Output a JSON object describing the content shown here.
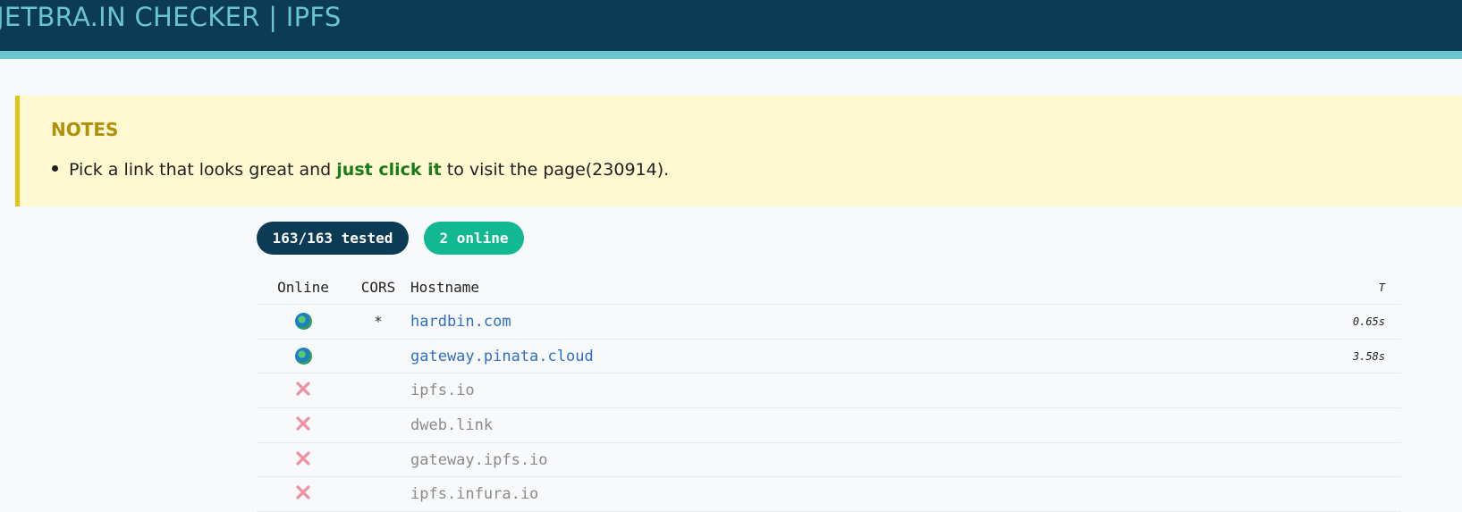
{
  "header": {
    "title": "JETBRA.IN CHECKER | IPFS"
  },
  "notes": {
    "title": "NOTES",
    "item_before": "Pick a link that looks great and ",
    "item_emphasis": "just click it",
    "item_after": " to visit the page(230914)."
  },
  "badges": {
    "tested": "163/163 tested",
    "online": "2 online"
  },
  "table": {
    "columns": {
      "online": "Online",
      "cors": "CORS",
      "hostname": "Hostname",
      "time": "T"
    },
    "rows": [
      {
        "online": "globe-icon",
        "cors": "*",
        "hostname": "hardbin.com",
        "time": "0.65s",
        "status": "online"
      },
      {
        "online": "globe-icon",
        "cors": "",
        "hostname": "gateway.pinata.cloud",
        "time": "3.58s",
        "status": "online"
      },
      {
        "online": "cross-icon",
        "cors": "",
        "hostname": "ipfs.io",
        "time": "",
        "status": "offline"
      },
      {
        "online": "cross-icon",
        "cors": "",
        "hostname": "dweb.link",
        "time": "",
        "status": "offline"
      },
      {
        "online": "cross-icon",
        "cors": "",
        "hostname": "gateway.ipfs.io",
        "time": "",
        "status": "offline"
      },
      {
        "online": "cross-icon",
        "cors": "",
        "hostname": "ipfs.infura.io",
        "time": "",
        "status": "offline"
      }
    ]
  },
  "colors": {
    "header_bg": "#0b3b55",
    "accent": "#6ac5cf",
    "online_badge": "#12b892",
    "link": "#2f6fc2",
    "offline_cross": "#ef8fa3"
  }
}
